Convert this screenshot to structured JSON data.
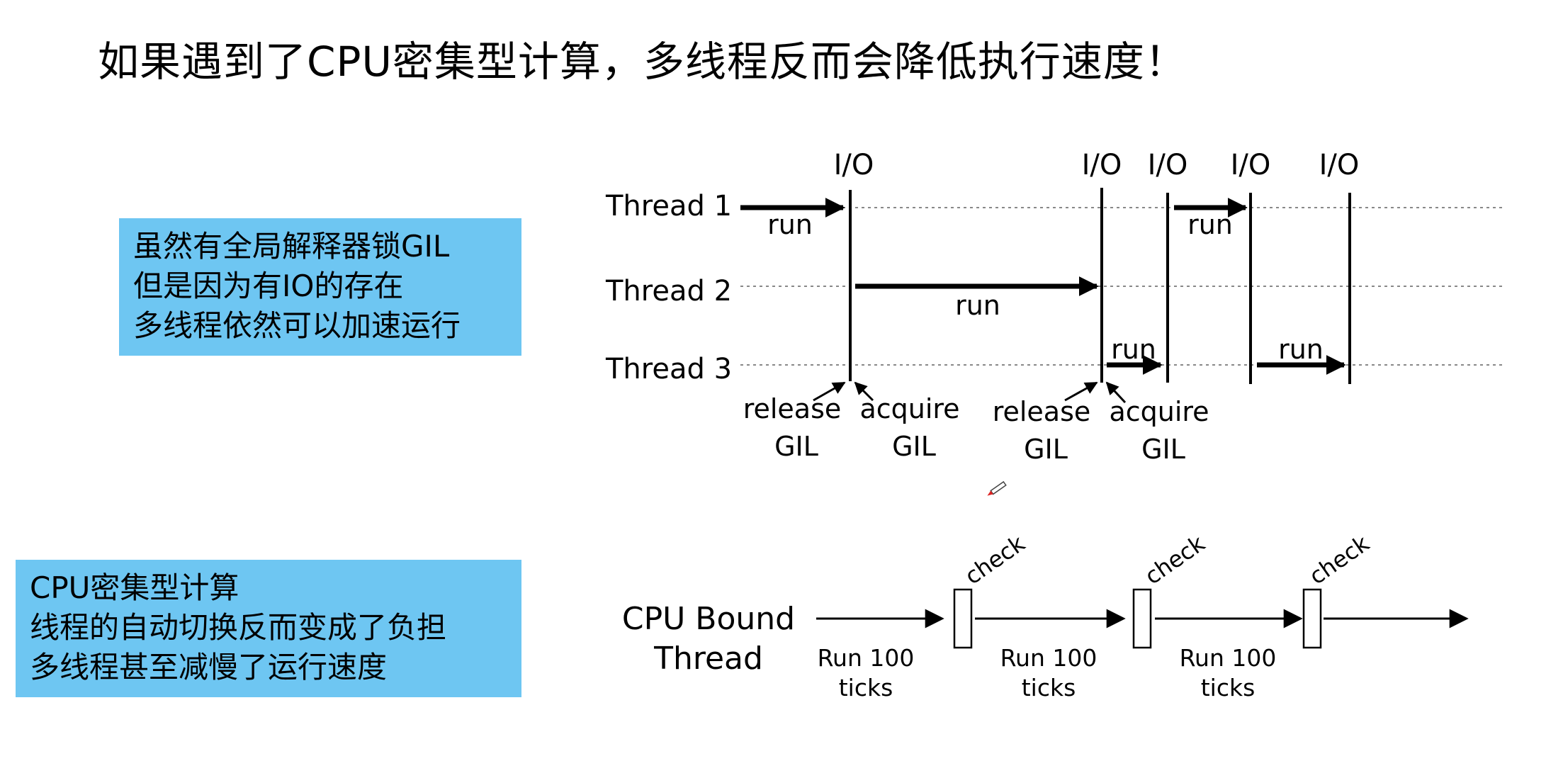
{
  "title": "如果遇到了CPU密集型计算，多线程反而会降低执行速度！",
  "callouts": {
    "gil": {
      "lines": [
        "虽然有全局解释器锁GIL",
        "但是因为有IO的存在",
        "多线程依然可以加速运行"
      ]
    },
    "cpu": {
      "lines": [
        "CPU密集型计算",
        "线程的自动切换反而变成了负担",
        "多线程甚至减慢了运行速度"
      ]
    }
  },
  "gil_diagram": {
    "threads": [
      "Thread 1",
      "Thread 2",
      "Thread 3"
    ],
    "io_label": "I/O",
    "run_label": "run",
    "release_label": [
      "release",
      "GIL"
    ],
    "acquire_label": [
      "acquire",
      "GIL"
    ]
  },
  "cpu_diagram": {
    "thread_label": [
      "CPU Bound",
      "Thread"
    ],
    "check_label": "check",
    "run_label": [
      "Run 100",
      "ticks"
    ]
  },
  "colors": {
    "callout_bg": "#6ec6f2",
    "line": "#000000"
  }
}
